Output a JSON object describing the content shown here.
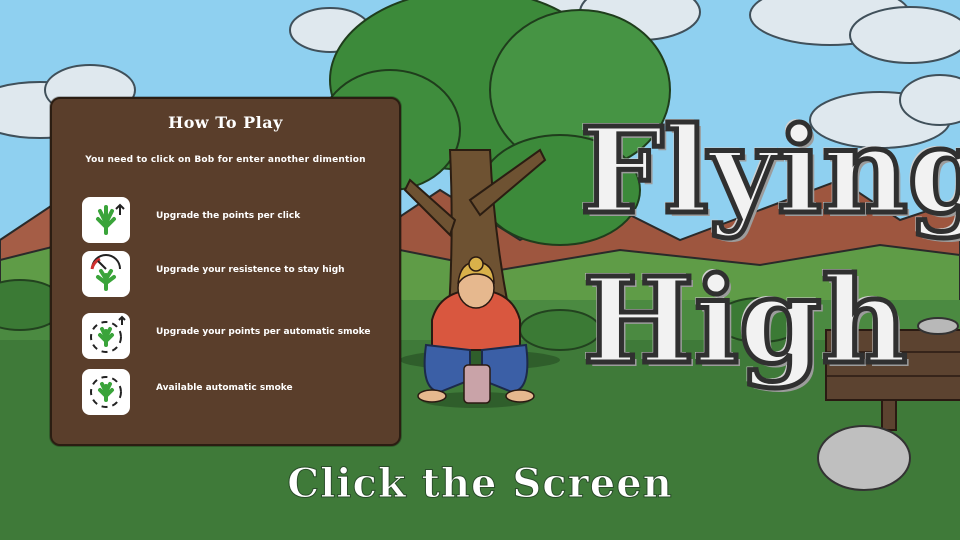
{
  "how_to_play": {
    "title": "How To Play",
    "subtitle": "You need to click on Bob for enter another dimention",
    "items": [
      {
        "label": "Upgrade the points per click",
        "icon": "leaf-up-arrow-icon"
      },
      {
        "label": "Upgrade your resistence to stay high",
        "icon": "leaf-gauge-icon"
      },
      {
        "label": "Upgrade your points per automatic smoke",
        "icon": "leaf-cycle-up-icon"
      },
      {
        "label": "Available automatic smoke",
        "icon": "leaf-cycle-icon"
      }
    ]
  },
  "logo": {
    "line1": "Flying",
    "line2": "High"
  },
  "prompt": "Click the Screen",
  "colors": {
    "sky": "#8fcfee",
    "grass": "#3f7a39",
    "panel": "#5a3e2b",
    "leaf": "#3aa43a"
  }
}
